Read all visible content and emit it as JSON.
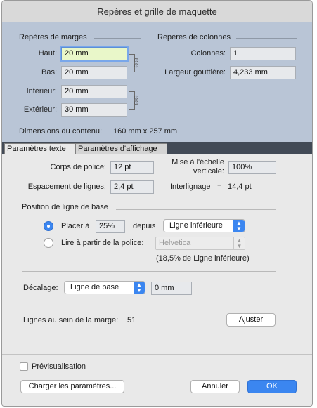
{
  "window": {
    "title": "Repères et grille de maquette"
  },
  "margins": {
    "heading": "Repères de marges",
    "top_label": "Haut:",
    "top_value": "20 mm",
    "bottom_label": "Bas:",
    "bottom_value": "20 mm",
    "inside_label": "Intérieur:",
    "inside_value": "20 mm",
    "outside_label": "Extérieur:",
    "outside_value": "30 mm"
  },
  "columns": {
    "heading": "Repères de colonnes",
    "count_label": "Colonnes:",
    "count_value": "1",
    "gutter_label": "Largeur gouttière:",
    "gutter_value": "4,233 mm"
  },
  "content_dimensions": {
    "label": "Dimensions du contenu:",
    "value": "160 mm x 257 mm"
  },
  "tabs": [
    {
      "label": "Paramètres texte",
      "active": true
    },
    {
      "label": "Paramètres d'affichage",
      "active": false
    }
  ],
  "text_settings": {
    "font_size_label": "Corps de police:",
    "font_size_value": "12 pt",
    "vscale_label_line1": "Mise à l'échelle",
    "vscale_label_line2": "verticale:",
    "vscale_value": "100%",
    "line_spacing_label": "Espacement de lignes:",
    "line_spacing_value": "2,4 pt",
    "leading_label": "Interlignage",
    "leading_eq": "=",
    "leading_value": "14,4 pt"
  },
  "baseline": {
    "heading": "Position de ligne de base",
    "place_label": "Placer à",
    "place_value": "25%",
    "from_label": "depuis",
    "from_option": "Ligne inférieure",
    "read_label": "Lire à partir de la police:",
    "font_option": "Helvetica",
    "note": "(18,5% de Ligne inférieure)"
  },
  "offset": {
    "label": "Décalage:",
    "option": "Ligne de base",
    "value": "0 mm"
  },
  "lines_in_margin": {
    "label": "Lignes au sein de la marge:",
    "value": "51",
    "adjust_button": "Ajuster"
  },
  "footer": {
    "preview_label": "Prévisualisation",
    "load_button": "Charger les paramètres...",
    "cancel_button": "Annuler",
    "ok_button": "OK"
  },
  "colors": {
    "accent": "#3b86f0",
    "upper_bg": "#b9c5d6",
    "tabbar_bg": "#424a56",
    "focus_field_bg": "#e9f7c9"
  },
  "icons": {
    "chain": "chain-link-icon",
    "popup_arrows": "up-down-arrows-icon"
  }
}
